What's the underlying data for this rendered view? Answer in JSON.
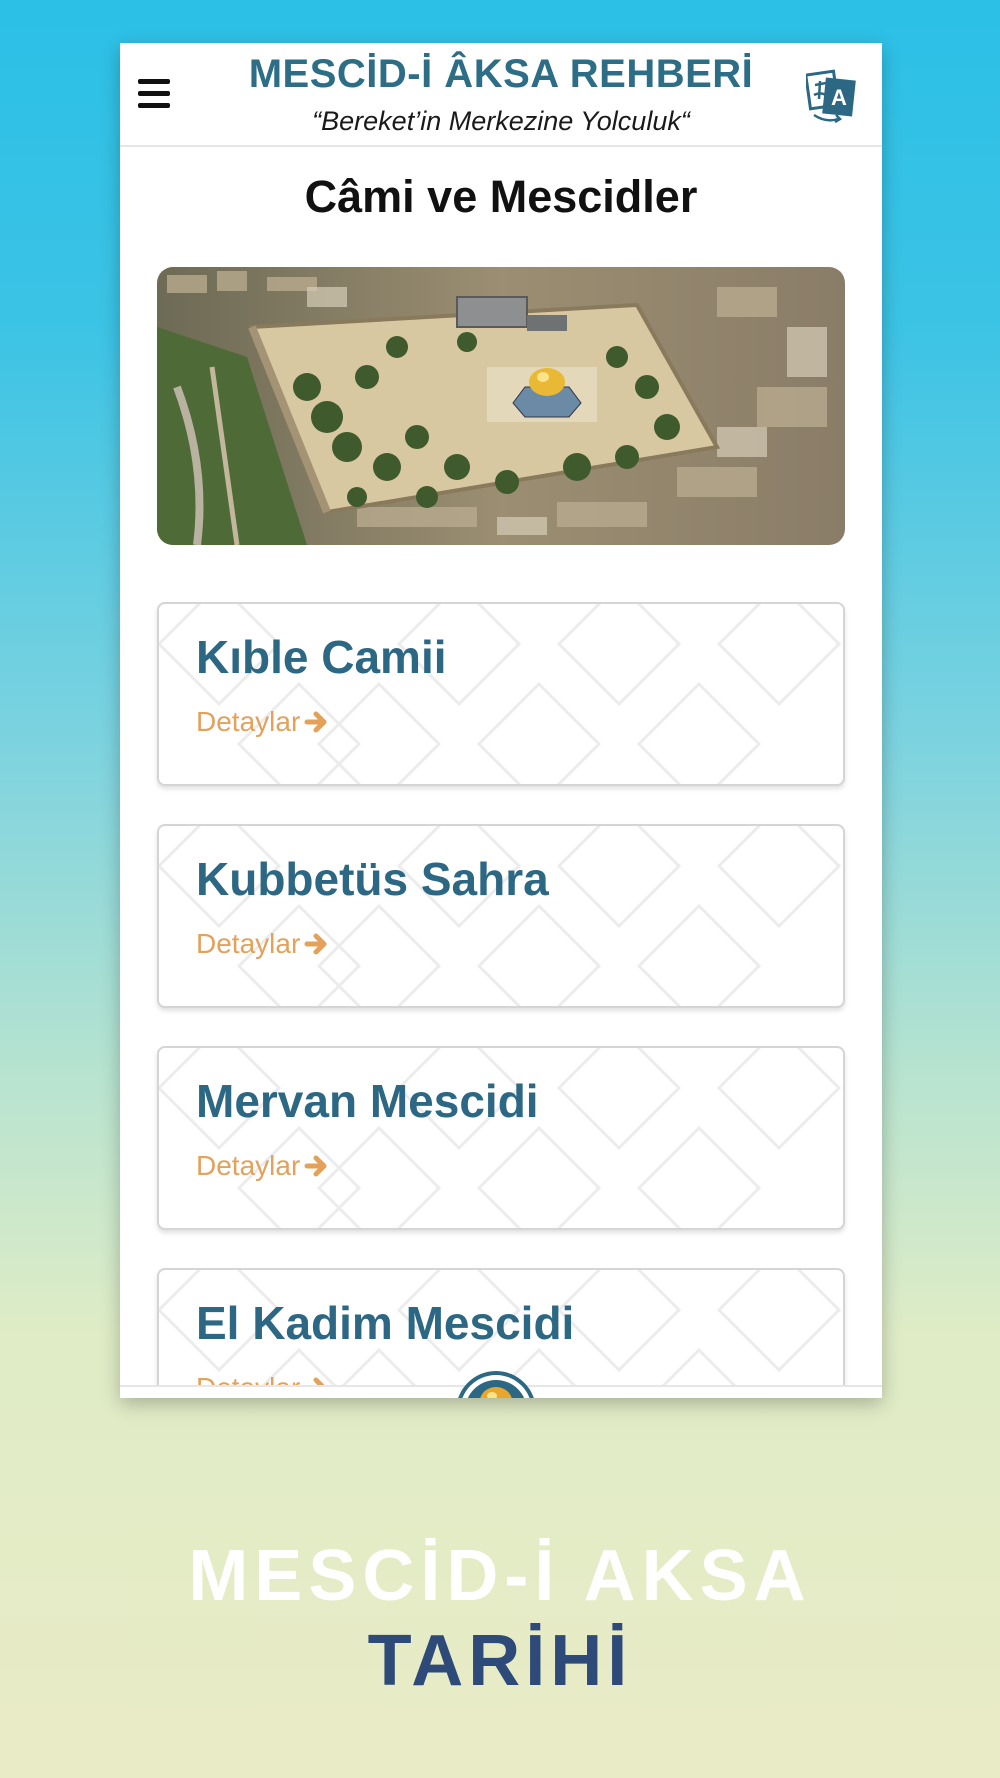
{
  "app": {
    "title": "MESCİD-İ ÂKSA REHBERİ",
    "subtitle": "“Bereket’in Merkezine Yolculuk“",
    "menu_icon": "hamburger-menu-icon",
    "language_icon": "translate-icon"
  },
  "page": {
    "title": "Câmi ve Mescidler",
    "hero_image": "aerial view of Al-Aqsa compound with golden Dome of the Rock"
  },
  "cards": [
    {
      "title": "Kıble Camii",
      "link": "Detaylar"
    },
    {
      "title": "Kubbetüs Sahra",
      "link": "Detaylar"
    },
    {
      "title": "Mervan Mescidi",
      "link": "Detaylar"
    },
    {
      "title": "El Kadim Mescidi",
      "link": "Detaylar"
    }
  ],
  "footer": {
    "line1": "MESCİD-İ AKSA",
    "line2": "TARİHİ"
  },
  "colors": {
    "primary": "#2c6883",
    "accent": "#e3a15a",
    "footer_dark": "#2e4a78"
  }
}
